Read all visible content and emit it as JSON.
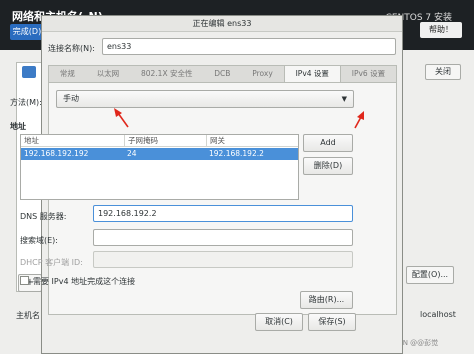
{
  "background": {
    "title": "网络和主机名(_N)",
    "done_button": "完成(D)",
    "installer_title": "CENTOS 7 安装",
    "help_button": "帮助！",
    "close_button": "关闭",
    "add_button": "+",
    "configure_button": "配置(O)...",
    "hostname_label": "主机名",
    "hostname_value": "localhost",
    "watermark": "CSDN @@彭觉"
  },
  "dialog": {
    "title": "正在编辑 ens33",
    "connection_name_label": "连接名称(N):",
    "connection_name_value": "ens33",
    "tabs": [
      {
        "label": "常规",
        "active": false
      },
      {
        "label": "以太网",
        "active": false
      },
      {
        "label": "802.1X 安全性",
        "active": false
      },
      {
        "label": "DCB",
        "active": false
      },
      {
        "label": "Proxy",
        "active": false
      },
      {
        "label": "IPv4 设置",
        "active": true
      },
      {
        "label": "IPv6 设置",
        "active": false
      }
    ],
    "method_label": "方法(M):",
    "method_value": "手动",
    "address_heading": "地址",
    "address_columns": [
      "地址",
      "子网掩码",
      "网关"
    ],
    "address_rows": [
      {
        "address": "192.168.192.192",
        "netmask": "24",
        "gateway": "192.168.192.2"
      }
    ],
    "add_button": "Add",
    "delete_button": "删除(D)",
    "dns_label": "DNS 服务器:",
    "dns_value": "192.168.192.2",
    "search_domains_label": "搜索域(E):",
    "search_domains_value": "",
    "dhcp_client_id_label": "DHCP 客户端 ID:",
    "dhcp_client_id_value": "",
    "require_ipv4_label": "需要 IPv4 地址完成这个连接",
    "require_ipv4_checked": false,
    "routes_button": "路由(R)...",
    "cancel_button": "取消(C)",
    "save_button": "保存(S)"
  },
  "colors": {
    "selection": "#4a90d9",
    "annotation_arrow": "#e0271b",
    "header_bg": "#1d2124"
  }
}
